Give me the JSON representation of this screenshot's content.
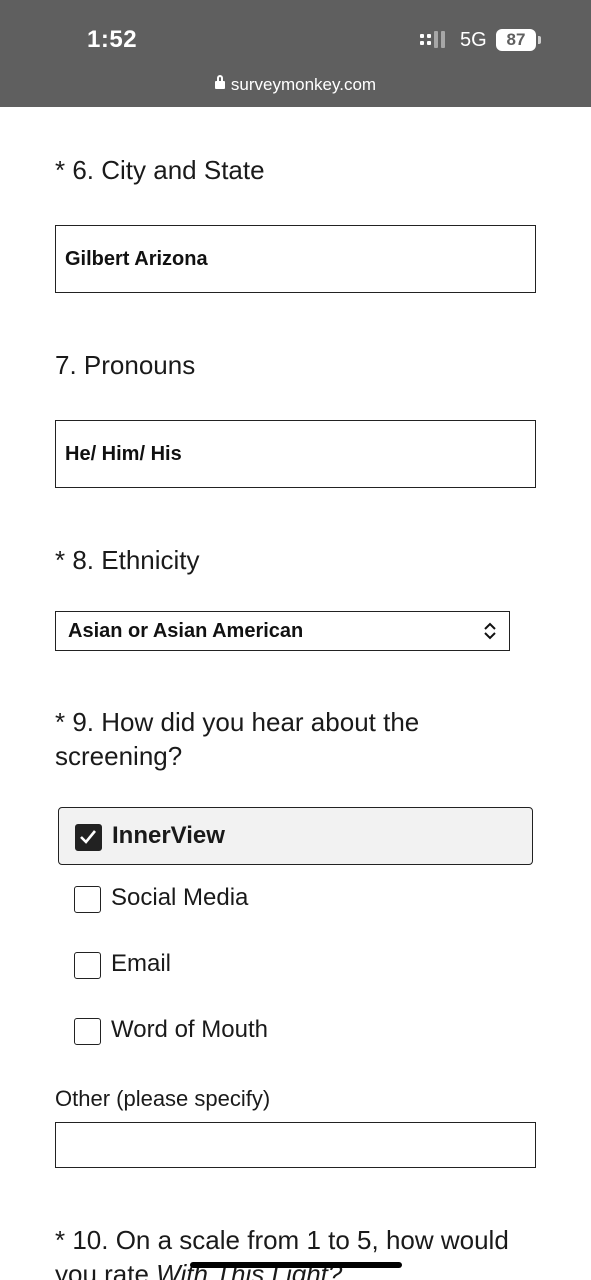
{
  "status_bar": {
    "time": "1:52",
    "network": "5G",
    "battery": "87",
    "url": "surveymonkey.com",
    "lock_icon": "lock-icon",
    "signal_icon": "signal-bars-icon"
  },
  "questions": {
    "q6": {
      "title": "* 6. City and State",
      "value": "Gilbert Arizona"
    },
    "q7": {
      "title": "7. Pronouns",
      "value": "He/ Him/ His"
    },
    "q8": {
      "title": "* 8. Ethnicity",
      "selected": "Asian or Asian American",
      "icon": "chevron-up-down-icon"
    },
    "q9": {
      "title_line1": "* 9. How did you hear about the",
      "title_line2": "screening?",
      "options": [
        {
          "label": "InnerView",
          "checked": true
        },
        {
          "label": "Social Media",
          "checked": false
        },
        {
          "label": "Email",
          "checked": false
        },
        {
          "label": "Word of Mouth",
          "checked": false
        }
      ],
      "other_label": "Other (please specify)",
      "other_value": ""
    },
    "q10": {
      "title_line1": "* 10. On a scale from 1 to 5, how would",
      "title_line2_prefix": "you rate ",
      "title_line2_italic": "With This Light?"
    }
  },
  "colors": {
    "status_bar_bg": "#5f5f5f",
    "selected_option_bg": "#f2f2f2",
    "border": "#222222"
  }
}
